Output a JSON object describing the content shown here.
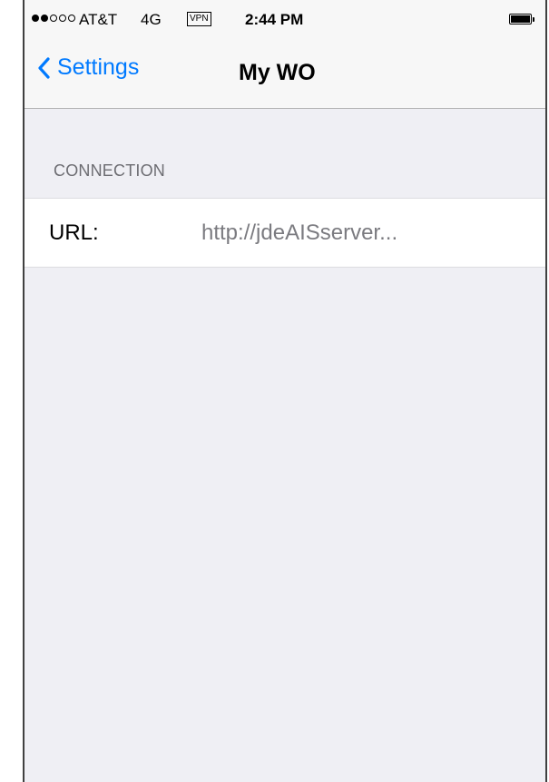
{
  "status_bar": {
    "signal_filled": 2,
    "signal_total": 5,
    "carrier": "AT&T",
    "network": "4G",
    "vpn": "VPN",
    "time": "2:44 PM",
    "battery_level": 1.0
  },
  "nav_bar": {
    "back_label": "Settings",
    "title": "My WO"
  },
  "sections": {
    "connection": {
      "header": "CONNECTION",
      "url_label": "URL:",
      "url_value": "http://jdeAISserver..."
    }
  },
  "colors": {
    "accent": "#007aff",
    "background": "#efeff4",
    "secondary_text": "#6d6d72"
  },
  "icons": {
    "back": "chevron-left-icon",
    "battery": "battery-icon"
  }
}
